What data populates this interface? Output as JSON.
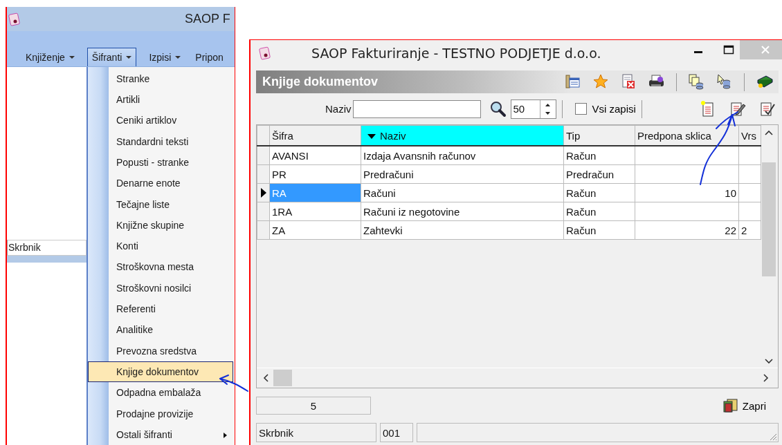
{
  "background_window": {
    "title": "SAOP F",
    "menu_bar": [
      {
        "label": "Knjiženje",
        "selected": false,
        "caret": true
      },
      {
        "label": "Šifranti",
        "selected": true,
        "caret": true
      },
      {
        "label": "Izpisi",
        "selected": false,
        "caret": true
      },
      {
        "label": "Pripon",
        "selected": false,
        "caret": false
      }
    ],
    "menu_items": [
      {
        "label": "Stranke",
        "selected": false,
        "submenu": false
      },
      {
        "label": "Artikli",
        "selected": false,
        "submenu": false
      },
      {
        "label": "Ceniki artiklov",
        "selected": false,
        "submenu": false
      },
      {
        "label": "Standardni teksti",
        "selected": false,
        "submenu": false
      },
      {
        "label": "Popusti - stranke",
        "selected": false,
        "submenu": false
      },
      {
        "label": "Denarne enote",
        "selected": false,
        "submenu": false
      },
      {
        "label": "Tečajne liste",
        "selected": false,
        "submenu": false
      },
      {
        "label": "Knjižne skupine",
        "selected": false,
        "submenu": false
      },
      {
        "label": "Konti",
        "selected": false,
        "submenu": false
      },
      {
        "label": "Stroškovna mesta",
        "selected": false,
        "submenu": false
      },
      {
        "label": "Stroškovni nosilci",
        "selected": false,
        "submenu": false
      },
      {
        "label": "Referenti",
        "selected": false,
        "submenu": false
      },
      {
        "label": "Analitike",
        "selected": false,
        "submenu": false
      },
      {
        "label": "Prevozna sredstva",
        "selected": false,
        "submenu": false
      },
      {
        "label": "Knjige dokumentov",
        "selected": true,
        "submenu": false
      },
      {
        "label": "Odpadna embalaža",
        "selected": false,
        "submenu": false
      },
      {
        "label": "Prodajne provizije",
        "selected": false,
        "submenu": false
      },
      {
        "label": "Ostali šifranti",
        "selected": false,
        "submenu": true
      }
    ],
    "status_field": "Skrbnik"
  },
  "window": {
    "title": "SAOP Fakturiranje - TESTNO PODJETJE d.o.o.",
    "panel_title": "Knjige dokumentov",
    "filter": {
      "label": "Naziv",
      "page_size": "50",
      "all_records": {
        "label": "Vsi zapisi",
        "checked": false
      }
    },
    "table": {
      "columns": [
        {
          "label": "Šifra",
          "sorted": false,
          "kind": "text"
        },
        {
          "label": "Naziv",
          "sorted": true,
          "kind": "text"
        },
        {
          "label": "Tip",
          "sorted": false,
          "kind": "text"
        },
        {
          "label": "Predpona sklica",
          "sorted": false,
          "kind": "number"
        },
        {
          "label": "Vrs",
          "sorted": false,
          "kind": "text"
        }
      ],
      "rows": [
        {
          "selected": false,
          "cells": [
            "AVANSI",
            "Izdaja Avansnih računov",
            "Račun",
            "",
            ""
          ]
        },
        {
          "selected": false,
          "cells": [
            "PR",
            "Predračuni",
            "Predračun",
            "",
            ""
          ]
        },
        {
          "selected": true,
          "cells": [
            "RA",
            "Računi",
            "Račun",
            "10",
            ""
          ]
        },
        {
          "selected": false,
          "cells": [
            "1RA",
            "Računi iz negotovine",
            "Račun",
            "",
            ""
          ]
        },
        {
          "selected": false,
          "cells": [
            "ZA",
            "Zahtevki",
            "Račun",
            "22",
            "2"
          ]
        }
      ]
    },
    "record_count": "5",
    "close_button": "Zapri",
    "status_bar": [
      "Skrbnik",
      "001"
    ]
  }
}
